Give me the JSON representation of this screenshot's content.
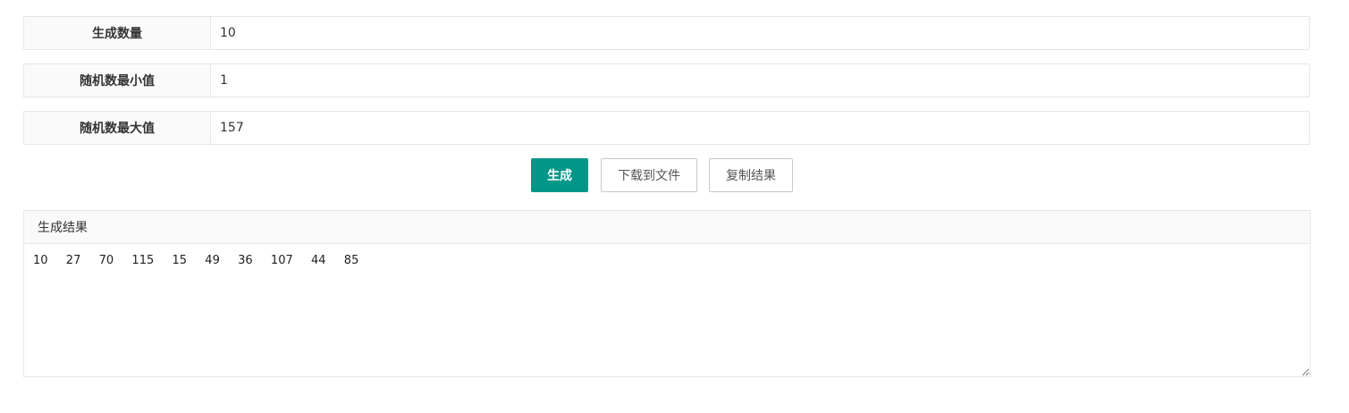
{
  "form": {
    "count": {
      "label": "生成数量",
      "value": "10"
    },
    "min": {
      "label": "随机数最小值",
      "value": "1"
    },
    "max": {
      "label": "随机数最大值",
      "value": "157"
    }
  },
  "buttons": {
    "generate": "生成",
    "download": "下载到文件",
    "copy": "复制结果"
  },
  "result": {
    "title": "生成结果",
    "text": "10  27  70  115  15  49  36  107  44  85"
  },
  "colors": {
    "primary": "#009688",
    "border": "#e6e6e6",
    "label_bg": "#fafafa"
  }
}
